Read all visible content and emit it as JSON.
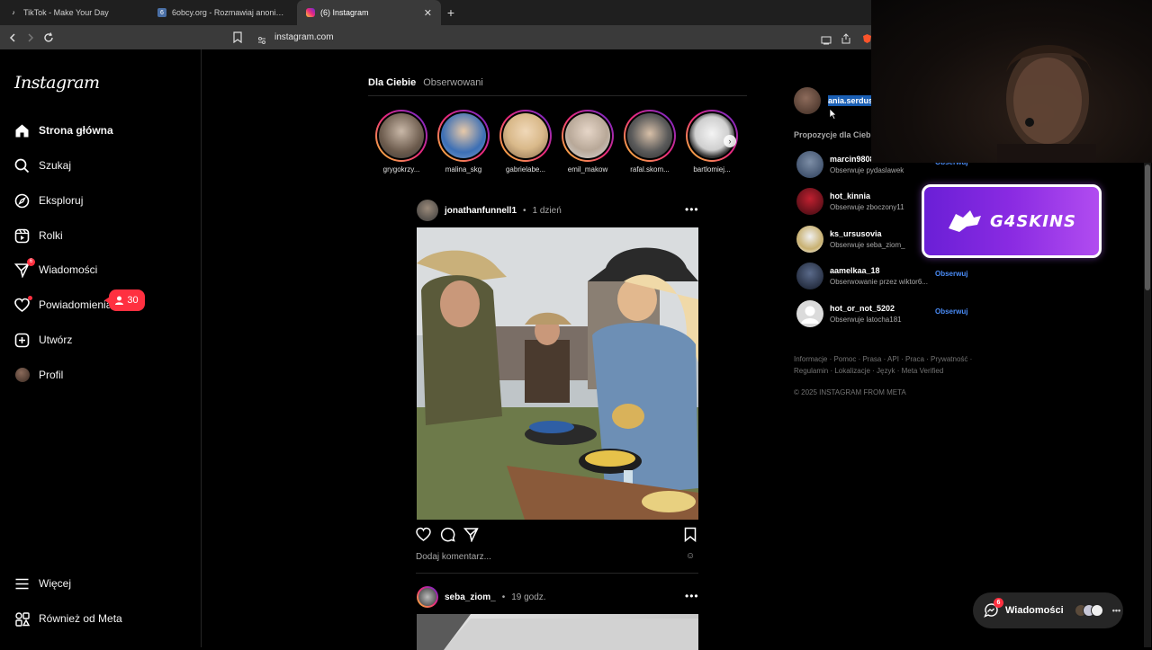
{
  "browser": {
    "tabs": [
      {
        "title": "TikTok - Make Your Day",
        "favicon": "tiktok-icon"
      },
      {
        "title": "6obcy.org - Rozmawiaj anonimowo :)",
        "favicon": "chat-icon"
      },
      {
        "title": "(6) Instagram",
        "favicon": "instagram-icon",
        "active": true
      }
    ],
    "url": "instagram.com"
  },
  "sidebar": {
    "logo": "Instagram",
    "items": [
      {
        "label": "Strona główna",
        "icon": "home-icon"
      },
      {
        "label": "Szukaj",
        "icon": "search-icon"
      },
      {
        "label": "Eksploruj",
        "icon": "compass-icon"
      },
      {
        "label": "Rolki",
        "icon": "reels-icon"
      },
      {
        "label": "Wiadomości",
        "icon": "messenger-icon",
        "badge": "6"
      },
      {
        "label": "Powiadomienia",
        "icon": "heart-icon"
      },
      {
        "label": "Utwórz",
        "icon": "plus-square-icon"
      },
      {
        "label": "Profil",
        "icon": "avatar"
      },
      {
        "label": "Więcej",
        "icon": "menu-icon"
      },
      {
        "label": "Również od Meta",
        "icon": "meta-apps-icon"
      }
    ],
    "notification_count": "30"
  },
  "feed": {
    "tabs": [
      "Dla Ciebie",
      "Obserwowani"
    ],
    "stories": [
      {
        "name": "grygokrzy..."
      },
      {
        "name": "malina_skg"
      },
      {
        "name": "gabrielabe..."
      },
      {
        "name": "emil_makow"
      },
      {
        "name": "rafal.skom..."
      },
      {
        "name": "bartlomiej..."
      }
    ],
    "post1": {
      "user": "jonathanfunnell1",
      "separator": "•",
      "time": "1 dzień",
      "comment_placeholder": "Dodaj komentarz..."
    },
    "post2": {
      "user": "seba_ziom_",
      "separator": "•",
      "time": "19 godz."
    }
  },
  "right": {
    "me": {
      "username": "ania.serdus"
    },
    "suggestions_title": "Propozycje dla Ciebie",
    "suggestions": [
      {
        "name": "marcin9808",
        "sub": "Obserwuje pydaslawek",
        "follow": "Obserwuj"
      },
      {
        "name": "hot_kinnia",
        "sub": "Obserwuje zboczony11",
        "follow": ""
      },
      {
        "name": "ks_ursusovia",
        "sub": "Obserwuje seba_ziom_",
        "follow": ""
      },
      {
        "name": "aamelkaa_18",
        "sub": "Obserwowanie przez wiktor6...",
        "follow": "Obserwuj"
      },
      {
        "name": "hot_or_not_5202",
        "sub": "Obserwuje latocha181",
        "follow": "Obserwuj"
      }
    ],
    "footer": "Informacje · Pomoc · Prasa · API · Praca · Prywatność · Regulamin · Lokalizacje · Język · Meta Verified",
    "copyright": "© 2025 INSTAGRAM FROM META"
  },
  "overlay": {
    "brand": "G4SKINS",
    "messages_label": "Wiadomości",
    "messages_badge": "6"
  },
  "colors": {
    "accent": "#4a8cf7",
    "badge": "#ff3040",
    "brand": "#8a2be2"
  }
}
